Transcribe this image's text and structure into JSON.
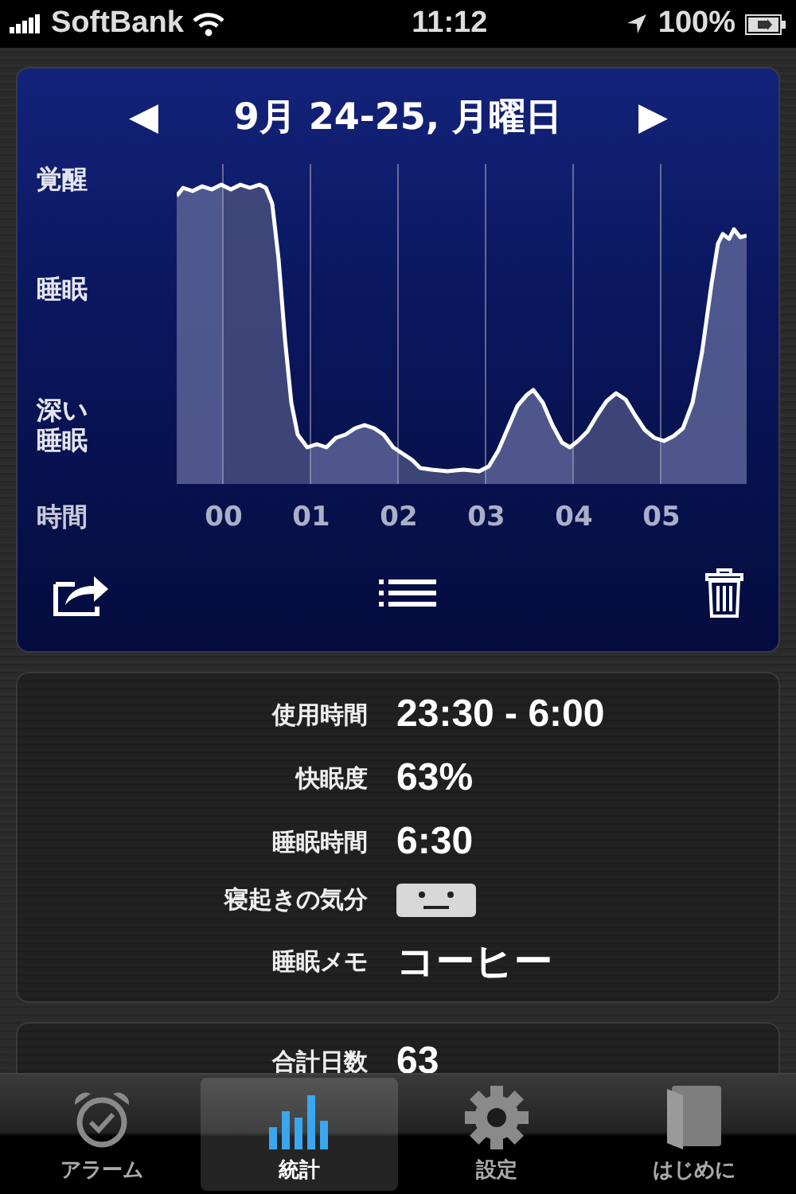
{
  "status_bar": {
    "carrier": "SoftBank",
    "time": "11:12",
    "battery": "100%"
  },
  "chart_card": {
    "title": "9月 24-25, 月曜日",
    "prev_arrow": "◀",
    "next_arrow": "▶",
    "y_labels": [
      "覚醒",
      "睡眠",
      "深い睡眠"
    ],
    "x_title": "時間",
    "x_labels": [
      "00",
      "01",
      "02",
      "03",
      "04",
      "05"
    ]
  },
  "stats": [
    {
      "kind": "text",
      "label": "使用時間",
      "value": "23:30 - 6:00"
    },
    {
      "kind": "text",
      "label": "快眠度",
      "value": "63%"
    },
    {
      "kind": "text",
      "label": "睡眠時間",
      "value": "6:30"
    },
    {
      "kind": "mood",
      "label": "寝起きの気分"
    },
    {
      "kind": "text",
      "label": "睡眠メモ",
      "value": "コーヒー"
    }
  ],
  "summary": [
    {
      "label": "合計日数",
      "value": "63"
    }
  ],
  "tabs": [
    {
      "label": "アラーム",
      "kind": "alarm",
      "selected": false
    },
    {
      "label": "統計",
      "kind": "stats",
      "selected": true
    },
    {
      "label": "設定",
      "kind": "settings",
      "selected": false
    },
    {
      "label": "はじめに",
      "kind": "guide",
      "selected": false
    }
  ]
}
